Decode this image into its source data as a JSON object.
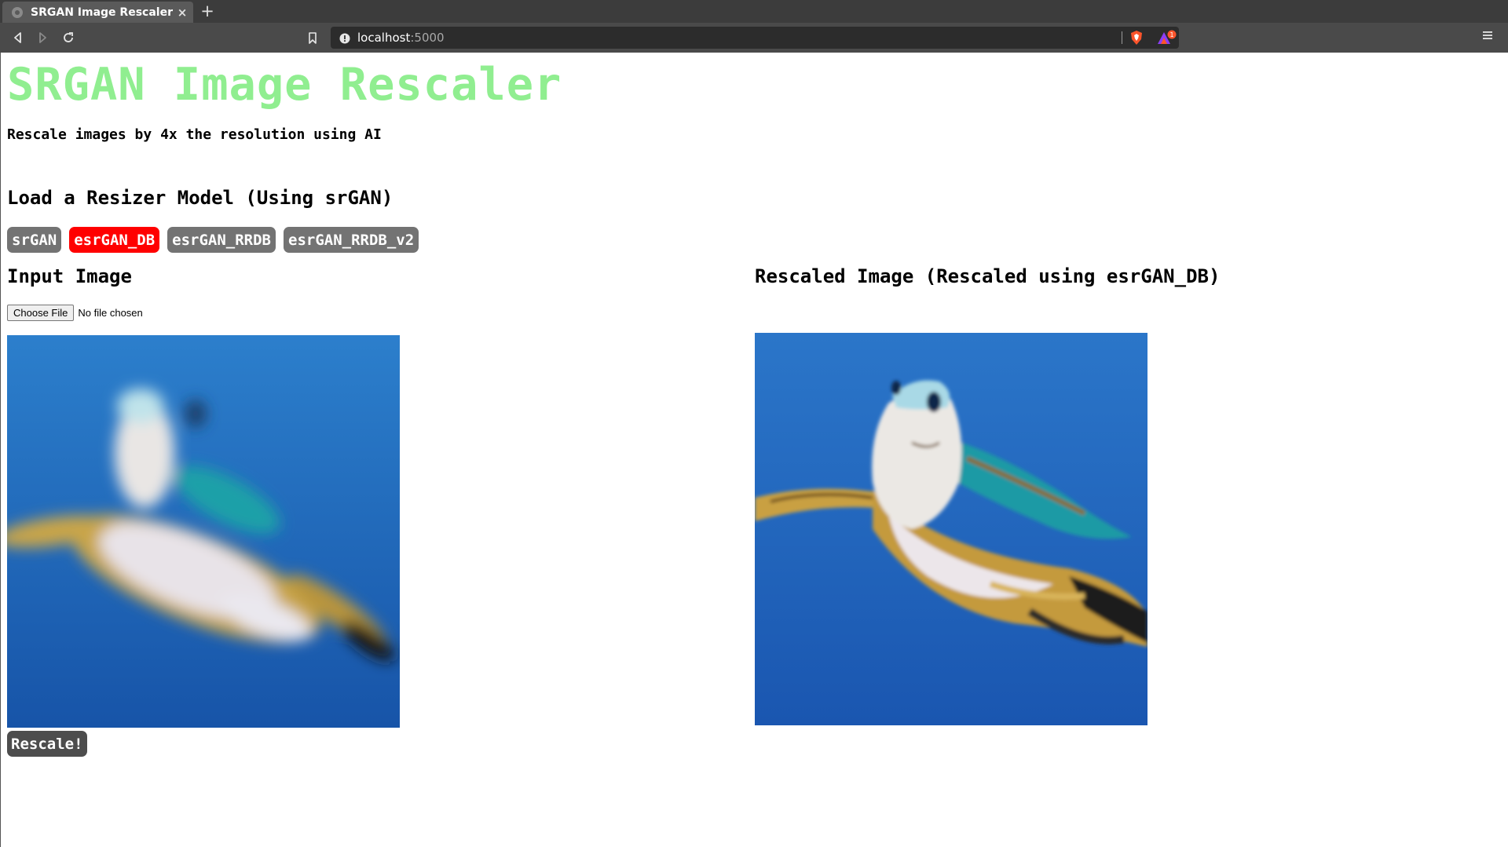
{
  "browser": {
    "tab_title": "SRGAN Image Rescaler",
    "tab_close": "×",
    "new_tab": "+",
    "url_host": "localhost",
    "url_port": ":5000",
    "rewards_badge": "1"
  },
  "page": {
    "title": "SRGAN Image Rescaler",
    "subtitle": "Rescale images by 4x the resolution using AI",
    "model_heading": "Load a Resizer Model (Using srGAN)",
    "models": [
      {
        "label": "srGAN",
        "active": false
      },
      {
        "label": "esrGAN_DB",
        "active": true
      },
      {
        "label": "esrGAN_RRDB",
        "active": false
      },
      {
        "label": "esrGAN_RRDB_v2",
        "active": false
      }
    ],
    "input_heading": "Input Image",
    "choose_file_label": "Choose File",
    "no_file_text": "No file chosen",
    "output_heading": "Rescaled Image (Rescaled using esrGAN_DB)",
    "rescale_label": "Rescale!"
  },
  "colors": {
    "title": "#90ee90",
    "active_model": "#ff0000",
    "model_button": "#737373",
    "rescale_button": "#4d4d4d",
    "water_blue": "#1f5fb0"
  },
  "icons": {
    "back": "back-arrow-icon",
    "forward": "forward-arrow-icon",
    "reload": "reload-icon",
    "bookmark": "bookmark-icon",
    "site_info": "info-icon",
    "shield": "brave-shield-icon",
    "rewards": "brave-rewards-icon",
    "menu": "hamburger-menu-icon"
  }
}
